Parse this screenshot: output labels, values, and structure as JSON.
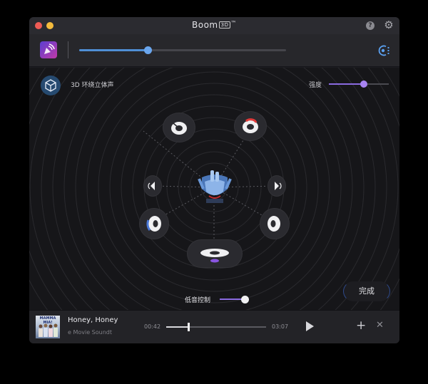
{
  "window": {
    "title": "Boom",
    "title_badge": "3D",
    "title_mark": "™"
  },
  "toolbar": {
    "volume_percent": 33
  },
  "surround": {
    "label": "3D 环绕立体声",
    "intensity_label": "强度",
    "intensity_percent": 58
  },
  "bass": {
    "label": "低音控制",
    "level_percent": 100
  },
  "done_button": {
    "label": "完成"
  },
  "player": {
    "album_art_title": "MAMMA MIA!",
    "track_title": "Honey, Honey",
    "track_album": "e Movie Soundt",
    "elapsed": "00:42",
    "duration": "03:07",
    "progress_percent": 22
  },
  "colors": {
    "accent_blue": "#4f8fd6",
    "accent_purple": "#8a6ae0",
    "surround_icon": "#264a70",
    "close_dot": "#ee5b55",
    "minimize_dot": "#f4bb3c"
  },
  "icons": {
    "help": "help-icon",
    "settings": "gear-icon",
    "app": "boom-app-icon",
    "equalizer": "equalizer-icon",
    "surround": "surround-cube-icon",
    "play": "play-icon",
    "add": "add-icon",
    "close": "close-icon"
  }
}
